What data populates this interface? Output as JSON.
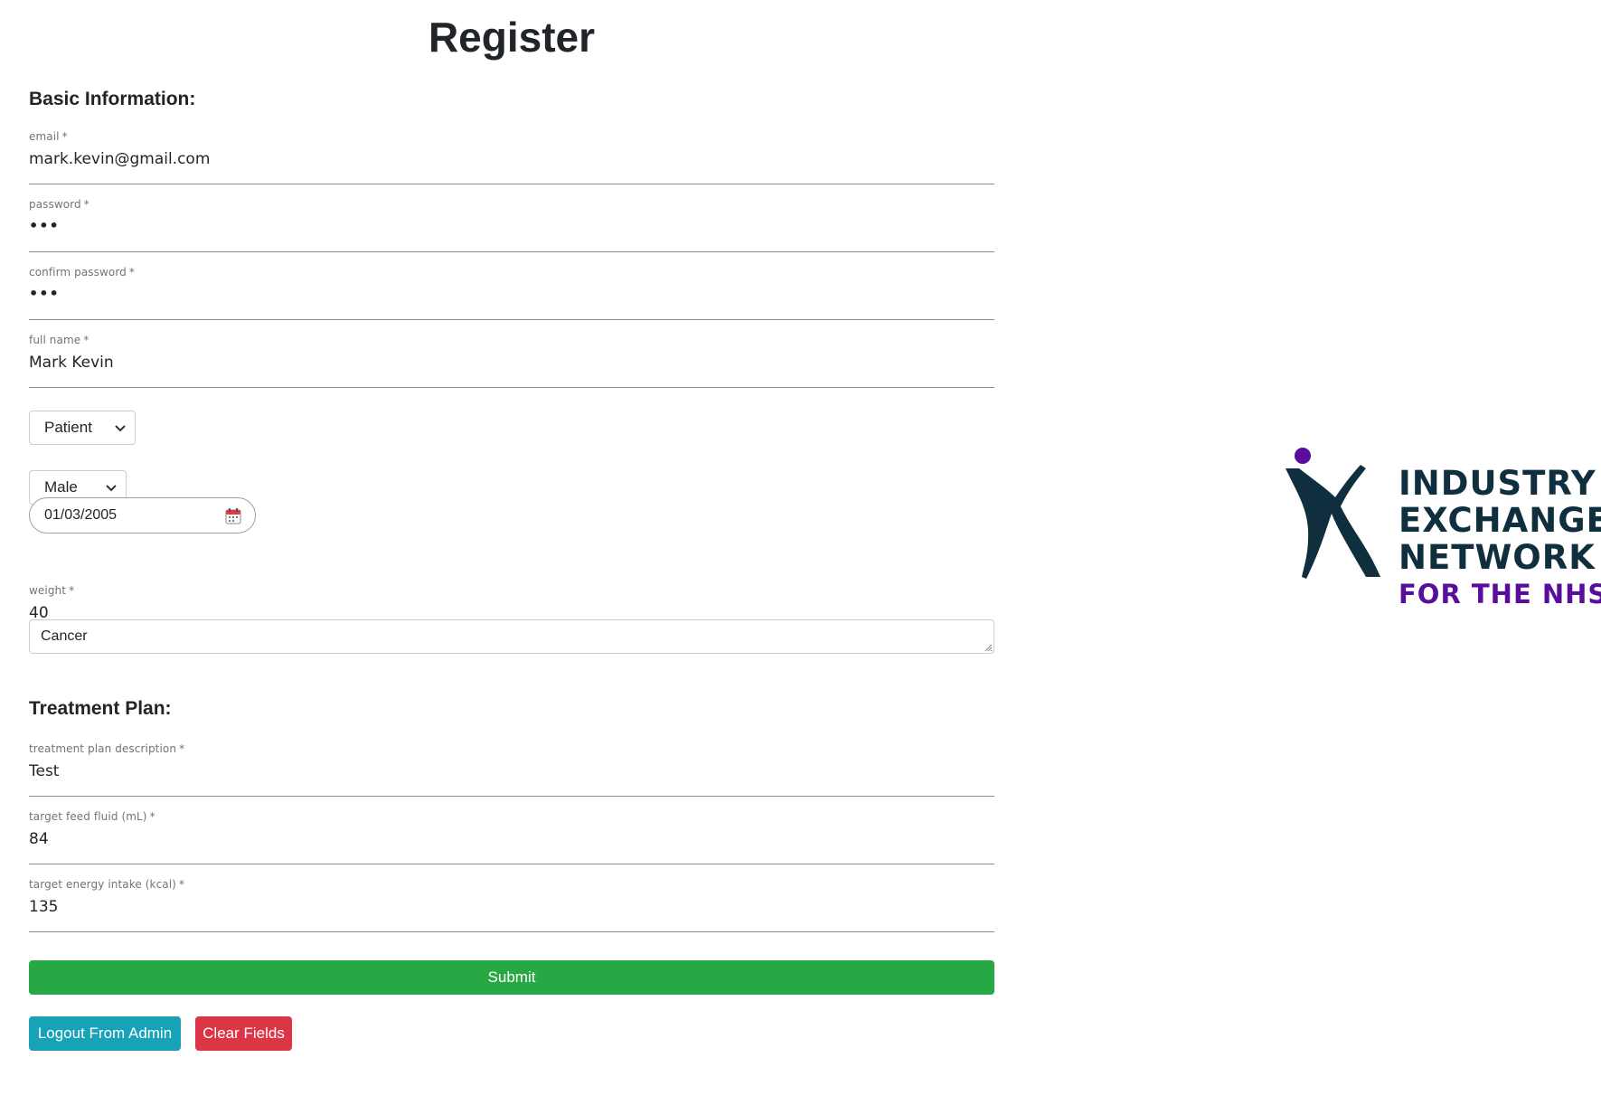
{
  "page": {
    "title": "Register"
  },
  "sections": {
    "basic_info": "Basic Information:",
    "treatment_plan": "Treatment Plan:"
  },
  "fields": {
    "email": {
      "label": "email",
      "required": "*",
      "value": "mark.kevin@gmail.com"
    },
    "password": {
      "label": "password",
      "required": "*",
      "value": "•••"
    },
    "confirm_password": {
      "label": "confirm password",
      "required": "*",
      "value": "•••"
    },
    "full_name": {
      "label": "full name",
      "required": "*",
      "value": "Mark Kevin"
    },
    "role": {
      "selected": "Patient"
    },
    "gender": {
      "selected": "Male"
    },
    "dob": {
      "value": "01/03/2005"
    },
    "weight": {
      "label": "weight",
      "required": "*",
      "value": "40"
    },
    "condition": {
      "value": "Cancer"
    },
    "treatment_description": {
      "label": "treatment plan description",
      "required": "*",
      "value": "Test"
    },
    "target_feed_fluid": {
      "label": "target feed fluid (mL)",
      "required": "*",
      "value": "84"
    },
    "target_energy_intake": {
      "label": "target energy intake (kcal)",
      "required": "*",
      "value": "135"
    }
  },
  "buttons": {
    "submit": "Submit",
    "logout": "Logout From Admin",
    "clear": "Clear Fields"
  },
  "logo": {
    "line1": "INDUSTRY",
    "line2": "EXCHANGE",
    "line3": "NETWORK",
    "line4": "FOR THE NHS",
    "colors": {
      "dark": "#0f2f3e",
      "purple": "#5a0c9c"
    }
  },
  "colors": {
    "submit": "#28a745",
    "logout": "#17a2b8",
    "clear": "#dc3545"
  }
}
